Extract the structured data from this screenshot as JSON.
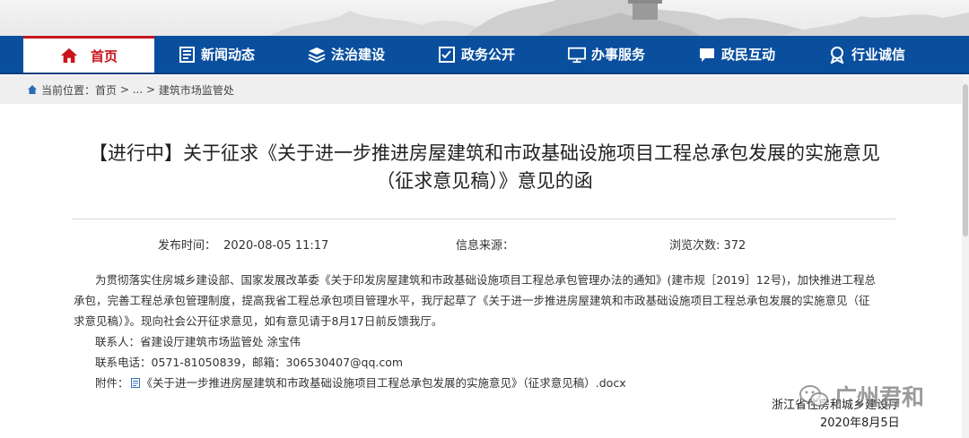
{
  "nav": {
    "items": [
      {
        "label": "首页",
        "icon": "home-icon"
      },
      {
        "label": "新闻动态",
        "icon": "newspaper-icon"
      },
      {
        "label": "法治建设",
        "icon": "layers-icon"
      },
      {
        "label": "政务公开",
        "icon": "checklist-icon"
      },
      {
        "label": "办事服务",
        "icon": "monitor-icon"
      },
      {
        "label": "政民互动",
        "icon": "chat-icon"
      },
      {
        "label": "行业诚信",
        "icon": "award-icon"
      }
    ],
    "active_color": "#c8161d",
    "bar_color": "#0a4f9e"
  },
  "breadcrumb": {
    "prefix": "当前位置：",
    "home": "首页",
    "sep1": " > ",
    "ellipsis": "...",
    "sep2": " > ",
    "current": "建筑市场监管处"
  },
  "article": {
    "title_line1": "【进行中】关于征求《关于进一步推进房屋建筑和市政基础设施项目工程总承包发展的实施意见",
    "title_line2": "（征求意见稿）》意见的函",
    "publish_label": "发布时间：",
    "publish_time": "2020-08-05 11:17",
    "source_label": "信息来源：",
    "views_label": "浏览次数: ",
    "views_count": "372",
    "paragraph_l1": "为贯彻落实住房城乡建设部、国家发展改革委《关于印发房屋建筑和市政基础设施项目工程总承包管理办法的通知》(建市规［2019］12号)，加快推进工程总",
    "paragraph_l2": "承包，完善工程总承包管理制度，提高我省工程总承包项目管理水平，我厅起草了《关于进一步推进房屋建筑和市政基础设施项目工程总承包发展的实施意见（征",
    "paragraph_l3": "求意见稿）》。现向社会公开征求意见，如有意见请于8月17日前反馈我厅。",
    "contact": "联系人：省建设厅建筑市场监管处 涂宝伟",
    "phone": "联系电话：0571-81050839，邮箱：306530407@qq.com",
    "attachment_label": "附件：",
    "attachment_name": "《关于进一步推进房屋建筑和市政基础设施项目工程总承包发展的实施意见》（征求意见稿）.docx",
    "sign_org": "浙江省住房和城乡建设厅",
    "sign_date": "2020年8月5日"
  },
  "watermark": {
    "text": "广州君和"
  }
}
